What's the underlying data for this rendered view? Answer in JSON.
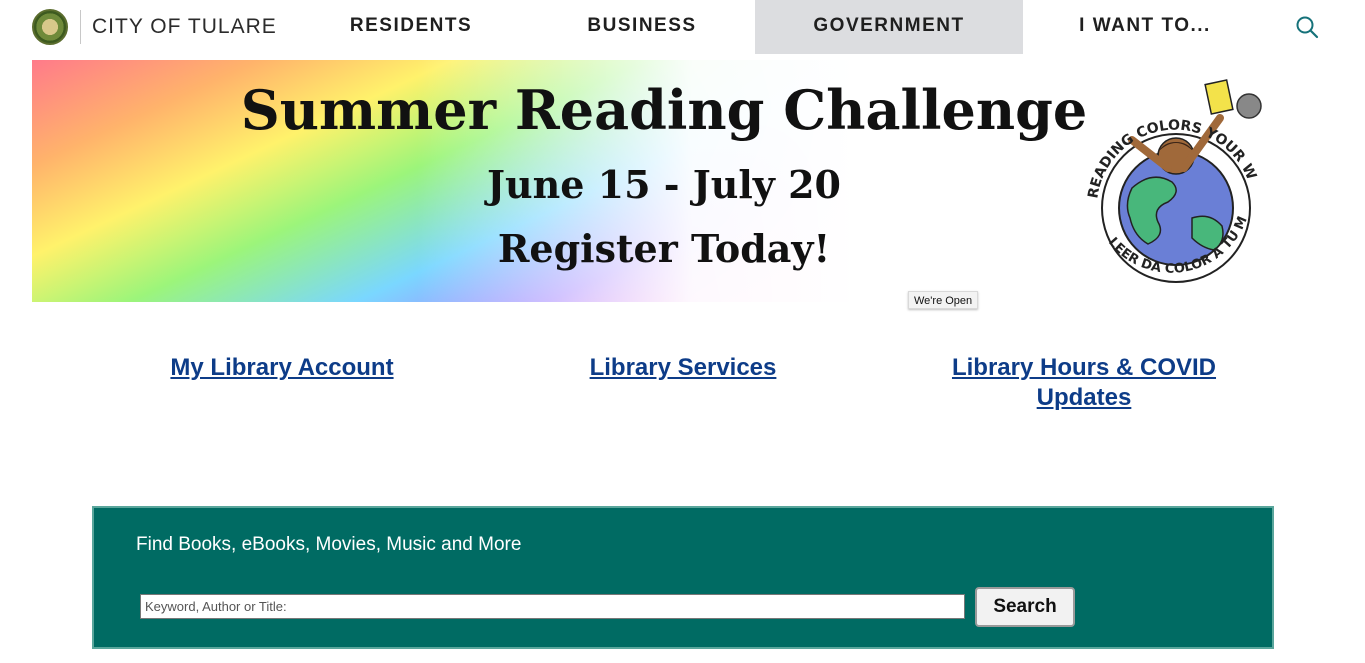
{
  "header": {
    "brand": "CITY OF TULARE",
    "nav": {
      "residents": "RESIDENTS",
      "business": "BUSINESS",
      "government": "GOVERNMENT",
      "i_want_to": "I WANT TO..."
    },
    "active_nav": "government",
    "active_color": "#dcdde0"
  },
  "banner": {
    "title": "Summer Reading Challenge",
    "dates": "June 15 - July 20",
    "cta": "Register Today!",
    "logo_text_top": "READING COLORS YOUR WORLD",
    "logo_text_bottom": "LEER DA COLOR A TU MUNDO"
  },
  "tooltip": "We're Open",
  "links": {
    "account": "My Library Account",
    "services": "Library Services",
    "hours_line1": "Library Hours & COVID",
    "hours_line2": "Updates"
  },
  "catalog": {
    "title": "Find Books, eBooks, Movies, Music and More",
    "placeholder": "Keyword, Author or Title:",
    "value": "",
    "button": "Search",
    "bg_color": "#006b63"
  }
}
